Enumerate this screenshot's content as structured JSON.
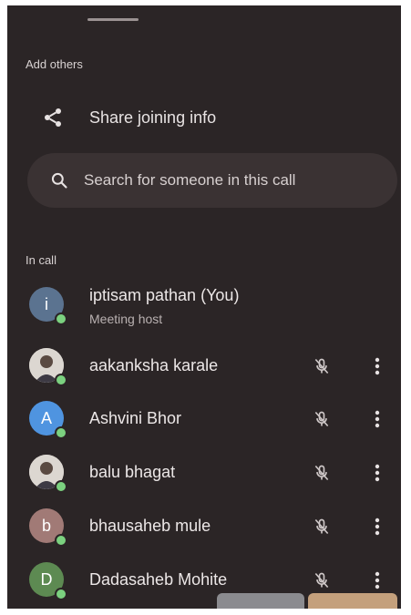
{
  "add_others": {
    "section_label": "Add others",
    "share_label": "Share joining info",
    "share_icon": "share-icon"
  },
  "search": {
    "placeholder": "Search for someone in this call",
    "icon": "search-icon"
  },
  "in_call": {
    "section_label": "In call",
    "participants": [
      {
        "name": "iptisam pathan (You)",
        "subtitle": "Meeting host",
        "avatar_initial": "i",
        "avatar_color": "#5b7390",
        "avatar_type": "initial",
        "muted": false
      },
      {
        "name": "aakanksha karale",
        "avatar_type": "photo",
        "muted": true
      },
      {
        "name": "Ashvini Bhor",
        "avatar_initial": "A",
        "avatar_color": "#4f94e0",
        "avatar_type": "initial",
        "muted": true
      },
      {
        "name": "balu bhagat",
        "avatar_type": "photo",
        "muted": true
      },
      {
        "name": "bhausaheb mule",
        "avatar_initial": "b",
        "avatar_color": "#a17a76",
        "avatar_type": "initial",
        "muted": true
      },
      {
        "name": "Dadasaheb Mohite",
        "avatar_initial": "D",
        "avatar_color": "#5d8a52",
        "avatar_type": "initial",
        "muted": true
      }
    ]
  },
  "colors": {
    "panel_background": "#2b2526",
    "search_background": "#3a3233",
    "online_indicator": "#7bd17f"
  }
}
